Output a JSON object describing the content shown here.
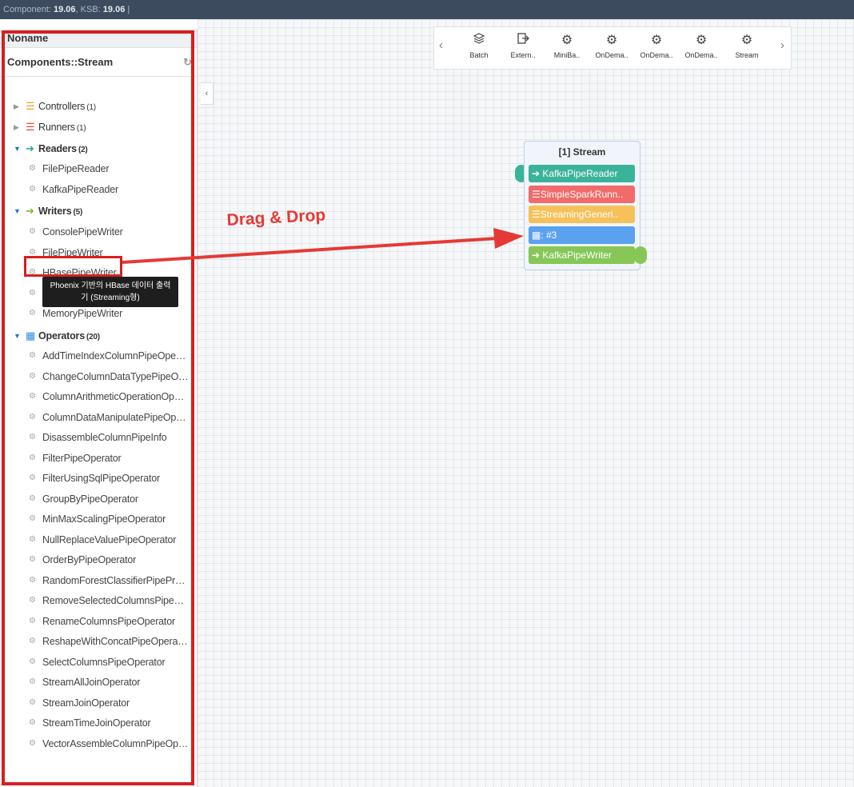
{
  "topbar": {
    "label_component": "Component:",
    "component_version": "19.06",
    "label_ksb": ", KSB:",
    "ksb_version": "19.06",
    "suffix": "|"
  },
  "sidebar": {
    "title": "Noname",
    "subtitle": "Components::Stream",
    "refresh_icon": "refresh-icon",
    "categories": [
      {
        "name": "Controllers",
        "count": "(1)",
        "expanded": false,
        "icon_color": "#f5a623"
      },
      {
        "name": "Runners",
        "count": "(1)",
        "expanded": false,
        "icon_color": "#e74c3c"
      },
      {
        "name": "Readers",
        "count": "(2)",
        "expanded": true,
        "icon_color": "#2eaa89"
      },
      {
        "name": "Writers",
        "count": "(5)",
        "expanded": true,
        "icon_color": "#7dbb2e"
      },
      {
        "name": "Operators",
        "count": "(20)",
        "expanded": true,
        "icon_color": "#2c8ce6"
      }
    ],
    "readers": [
      "FilePipeReader",
      "KafkaPipeReader"
    ],
    "writers": [
      "ConsolePipeWriter",
      "FilePipeWriter",
      "HBasePipeWriter",
      "",
      "MemoryPipeWriter"
    ],
    "operators": [
      "AddTimeIndexColumnPipeOperator",
      "ChangeColumnDataTypePipeOperator",
      "ColumnArithmeticOperationOperator",
      "ColumnDataManipulatePipeOperator",
      "DisassembleColumnPipeInfo",
      "FilterPipeOperator",
      "FilterUsingSqlPipeOperator",
      "GroupByPipeOperator",
      "MinMaxScalingPipeOperator",
      "NullReplaceValuePipeOperator",
      "OrderByPipeOperator",
      "RandomForestClassifierPipePredictOperator",
      "RemoveSelectedColumnsPipeOperator",
      "RenameColumnsPipeOperator",
      "ReshapeWithConcatPipeOperator",
      "SelectColumnsPipeOperator",
      "StreamAllJoinOperator",
      "StreamJoinOperator",
      "StreamTimeJoinOperator",
      "VectorAssembleColumnPipeOperator"
    ],
    "tooltip_line1": "Phoenix 기반의 HBase 데이터 출력",
    "tooltip_line2": "기 (Streaming형)"
  },
  "palette": {
    "items": [
      {
        "label": "Batch",
        "icon": "layers-icon"
      },
      {
        "label": "Extern..",
        "icon": "export-icon"
      },
      {
        "label": "MiniBa..",
        "icon": "gears-icon"
      },
      {
        "label": "OnDema..",
        "icon": "gears-icon"
      },
      {
        "label": "OnDema..",
        "icon": "gears-icon"
      },
      {
        "label": "OnDema..",
        "icon": "hand-gear-icon"
      },
      {
        "label": "Stream",
        "icon": "gears-icon"
      }
    ]
  },
  "stream_node": {
    "title": "[1] Stream",
    "blocks": [
      {
        "label": "KafkaPipeReader",
        "color": "#3bb39a"
      },
      {
        "label": "SimpleSparkRunn..",
        "color": "#f16b6b"
      },
      {
        "label": "StreamingGeneri..",
        "color": "#f5c15a"
      },
      {
        "label": ": #3",
        "color": "#5aa1f0"
      },
      {
        "label": "KafkaPipeWriter",
        "color": "#86c757"
      }
    ]
  },
  "annotation": {
    "text": "Drag & Drop",
    "color": "#e53935"
  }
}
